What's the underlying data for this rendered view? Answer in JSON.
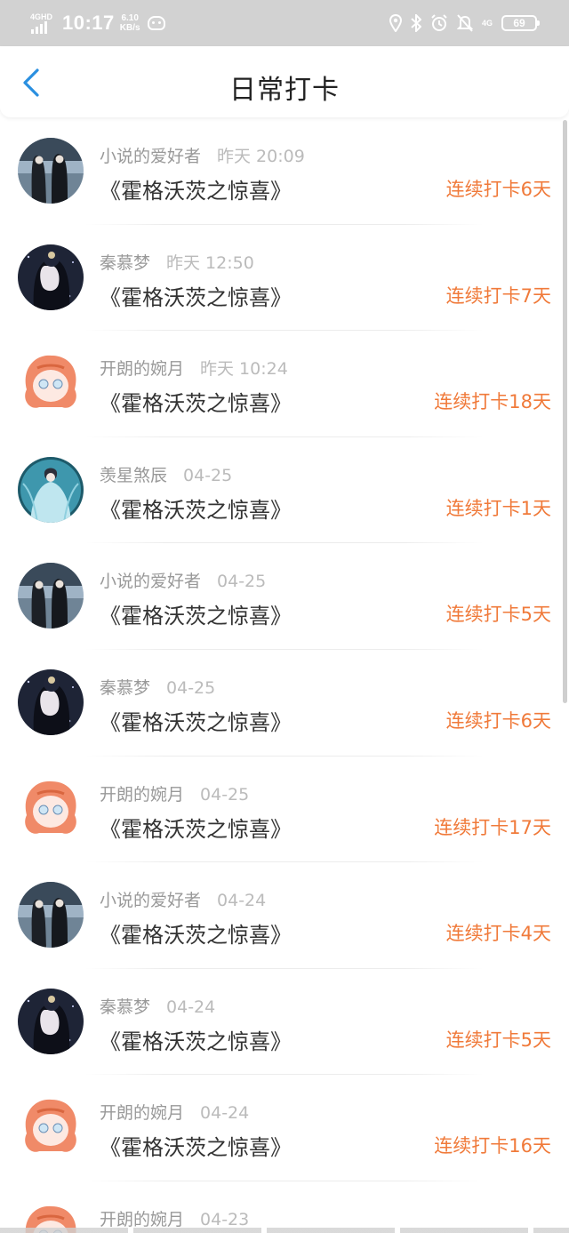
{
  "status_bar": {
    "network": "4GHD",
    "time": "10:17",
    "speed_value": "6.10",
    "speed_unit": "KB/s",
    "network_right": "4G",
    "battery": "69"
  },
  "header": {
    "title": "日常打卡",
    "accent_color": "#2a8fe0"
  },
  "streak_color": "#f07a3a",
  "checkins": [
    {
      "user": "小说的爱好者",
      "time": "昨天 20:09",
      "book": "《霍格沃茨之惊喜》",
      "streak": "连续打卡6天",
      "avatar": "twins-avatar"
    },
    {
      "user": "秦慕梦",
      "time": "昨天 12:50",
      "book": "《霍格沃茨之惊喜》",
      "streak": "连续打卡7天",
      "avatar": "dark-hair-avatar"
    },
    {
      "user": "开朗的婉月",
      "time": "昨天 10:24",
      "book": "《霍格沃茨之惊喜》",
      "streak": "连续打卡18天",
      "avatar": "chibi-avatar"
    },
    {
      "user": "羡星煞辰",
      "time": "04-25",
      "book": "《霍格沃茨之惊喜》",
      "streak": "连续打卡1天",
      "avatar": "blue-robe-avatar"
    },
    {
      "user": "小说的爱好者",
      "time": "04-25",
      "book": "《霍格沃茨之惊喜》",
      "streak": "连续打卡5天",
      "avatar": "twins-avatar"
    },
    {
      "user": "秦慕梦",
      "time": "04-25",
      "book": "《霍格沃茨之惊喜》",
      "streak": "连续打卡6天",
      "avatar": "dark-hair-avatar"
    },
    {
      "user": "开朗的婉月",
      "time": "04-25",
      "book": "《霍格沃茨之惊喜》",
      "streak": "连续打卡17天",
      "avatar": "chibi-avatar"
    },
    {
      "user": "小说的爱好者",
      "time": "04-24",
      "book": "《霍格沃茨之惊喜》",
      "streak": "连续打卡4天",
      "avatar": "twins-avatar"
    },
    {
      "user": "秦慕梦",
      "time": "04-24",
      "book": "《霍格沃茨之惊喜》",
      "streak": "连续打卡5天",
      "avatar": "dark-hair-avatar"
    },
    {
      "user": "开朗的婉月",
      "time": "04-24",
      "book": "《霍格沃茨之惊喜》",
      "streak": "连续打卡16天",
      "avatar": "chibi-avatar"
    },
    {
      "user": "开朗的婉月",
      "time": "04-23",
      "book": "",
      "streak": "",
      "avatar": "chibi-avatar"
    }
  ]
}
